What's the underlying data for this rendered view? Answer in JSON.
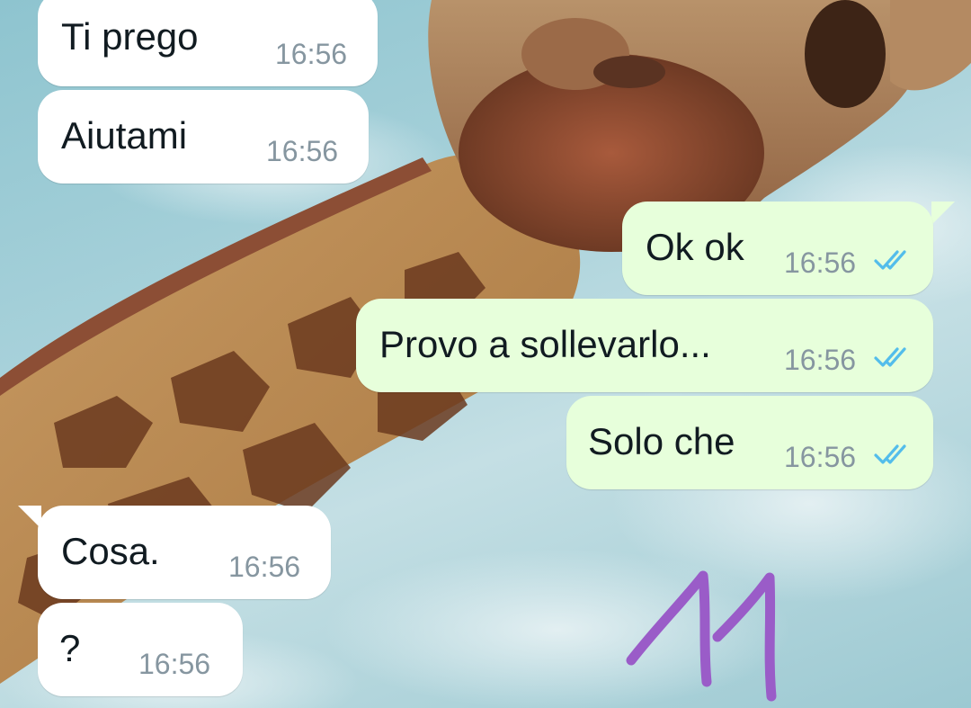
{
  "messages": [
    {
      "id": "m1",
      "direction": "incoming",
      "text": "Ti prego",
      "time": "16:56"
    },
    {
      "id": "m2",
      "direction": "incoming",
      "text": "Aiutami",
      "time": "16:56"
    },
    {
      "id": "m3",
      "direction": "outgoing",
      "text": "Ok ok",
      "time": "16:56",
      "status": "read"
    },
    {
      "id": "m4",
      "direction": "outgoing",
      "text": "Provo a sollevarlo...",
      "time": "16:56",
      "status": "read"
    },
    {
      "id": "m5",
      "direction": "outgoing",
      "text": "Solo che",
      "time": "16:56",
      "status": "read"
    },
    {
      "id": "m6",
      "direction": "incoming",
      "text": "Cosa.",
      "time": "16:56"
    },
    {
      "id": "m7",
      "direction": "incoming",
      "text": "?",
      "time": "16:56"
    }
  ],
  "doodle": {
    "text": "11",
    "color": "#9a5cc8"
  },
  "colors": {
    "incoming_bubble": "#ffffff",
    "outgoing_bubble": "#e7ffdb",
    "read_ticks": "#53bdeb",
    "time_text": "#8696a0"
  },
  "icons": {
    "read_status": "double-check-icon"
  },
  "wallpaper": "giraffe-sky-photo"
}
